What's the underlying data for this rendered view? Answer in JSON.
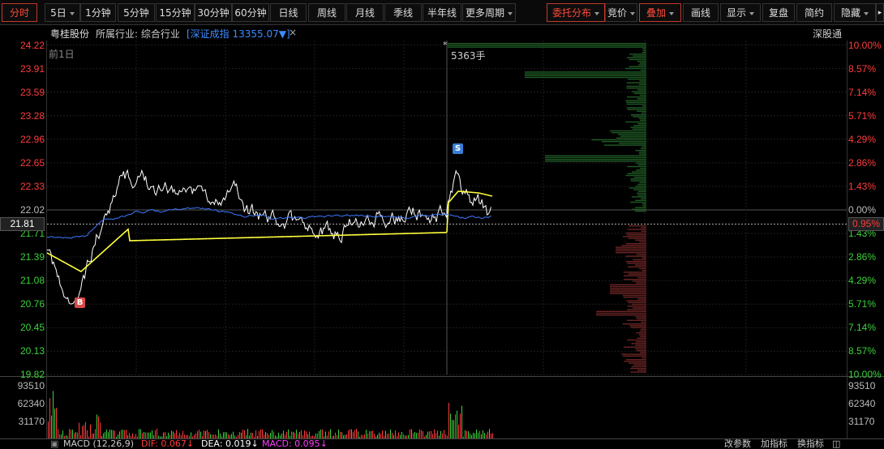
{
  "toolbar": {
    "left_tabs": [
      "分时",
      "5日",
      "1分钟",
      "5分钟",
      "15分钟",
      "30分钟",
      "60分钟",
      "日线",
      "周线",
      "月线",
      "季线",
      "半年线",
      "更多周期"
    ],
    "right_tabs": [
      "委托分布",
      "竞价",
      "叠加",
      "画线",
      "显示",
      "复盘",
      "简约",
      "隐藏"
    ]
  },
  "info": {
    "stock_name": "粤桂股份",
    "industry": "所属行业: 综合行业",
    "index": "[深证成指 13355.07▼]",
    "close": "×",
    "board": "深股通",
    "prev_day": "前1日",
    "volume_label": "5363手"
  },
  "axis": {
    "prices": [
      "24.22",
      "23.91",
      "23.59",
      "23.28",
      "22.96",
      "22.65",
      "22.33",
      "22.02",
      "21.71",
      "21.39",
      "21.08",
      "20.76",
      "20.45",
      "20.13",
      "19.82"
    ],
    "pcts": [
      "10.00%",
      "8.57%",
      "7.14%",
      "5.71%",
      "4.29%",
      "2.86%",
      "1.43%",
      "0.00%",
      "1.43%",
      "2.86%",
      "4.29%",
      "5.71%",
      "7.14%",
      "8.57%",
      "10.00%"
    ],
    "current_price": "21.81",
    "current_pct": "0.95%",
    "volume_ticks": [
      "93510",
      "62340",
      "31170"
    ]
  },
  "markers": {
    "buy": "B",
    "sell": "S"
  },
  "bottom": {
    "macd_title": "MACD (12,26,9)",
    "dif": "DIF: 0.067↓",
    "dea": "DEA: 0.019↓",
    "macd": "MACD: 0.095↓",
    "btn1": "改参数",
    "btn2": "加指标",
    "btn3": "换指标"
  },
  "colors": {
    "up": "#ff3c3c",
    "down": "#3cd23c",
    "price_line": "#ffffff",
    "avg_line": "#ffff3c",
    "index_line": "#3c78ff",
    "ask_bar": "#1f5a24",
    "bid_bar": "#6a2424"
  }
}
